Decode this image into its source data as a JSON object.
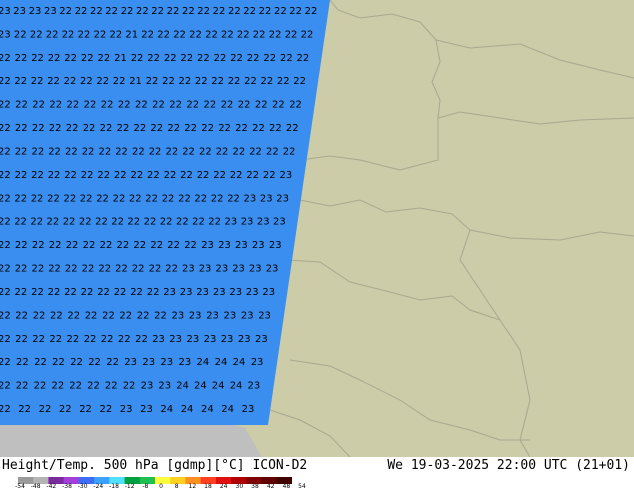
{
  "title": {
    "left": "Height/Temp. 500 hPa [gdmp][°C] ICON-D2",
    "right": "We 19-03-2025 22:00 UTC (21+01)"
  },
  "colors": {
    "land": "#cccca8",
    "sea": "#bfbfbf",
    "overlay": "#3a8ef0",
    "border": "#a8a890"
  },
  "colorbar": {
    "ticks": [
      "-54",
      "-48",
      "-42",
      "-38",
      "-30",
      "-24",
      "-18",
      "-12",
      "-8",
      "0",
      "8",
      "12",
      "18",
      "24",
      "30",
      "38",
      "42",
      "48",
      "54"
    ],
    "colors": [
      "#9a9a9a",
      "#b4b4b4",
      "#7a2a9e",
      "#a040d8",
      "#3c6cf0",
      "#3ca0ff",
      "#50e0ff",
      "#00a040",
      "#20c050",
      "#ffff40",
      "#ffd020",
      "#ff9020",
      "#ff4020",
      "#e01010",
      "#b00000",
      "#800000",
      "#600000",
      "#400000"
    ]
  },
  "temp_rows": [
    "23 23 23 23 22 22 22 22 22 22 22 22 22 22 22 22 22 22 22 22 22",
    "23 22 22 22 22 22 22 22 21 22 22 22 22 22 22 22 22 22 22 22",
    "22 22 22 22 22 22 22 21 22 22 22 22 22 22 22 22 22 22 22",
    "22 22 22 22 22 22 22 22 21 22 22 22 22 22 22 22 22 22 22",
    "22 22 22 22 22 22 22 22 22 22 22 22 22 22 22 22 22 22",
    "22 22 22 22 22 22 22 22 22 22 22 22 22 22 22 22 22 22",
    "22 22 22 22 22 22 22 22 22 22 22 22 22 22 22 22 22 22",
    "22 22 22 22 22 22 22 22 22 22 22 22 22 22 22 22 22 23",
    "22 22 22 22 22 22 22 22 22 22 22 22 22 22 22 23 23 23",
    "22 22 22 22 22 22 22 22 22 22 22 22 22 22 23 23 23 23",
    "22 22 22 22 22 22 22 22 22 22 22 22 23 23 23 23 23",
    "22 22 22 22 22 22 22 22 22 22 22 23 23 23 23 23 23",
    "22 22 22 22 22 22 22 22 22 22 23 23 23 23 23 23 23",
    "22 22 22 22 22 22 22 22 22 22 23 23 23 23 23 23",
    "22 22 22 22 22 22 22 22 22 23 23 23 23 23 23 23",
    "22 22 22 22 22 22 22 23 23 23 23 24 24 24 23",
    "22 22 22 22 22 22 22 22 23 23 24 24 24 24 23",
    "22 22 22 22 22 22 23 23 24 24 24 24 23"
  ]
}
